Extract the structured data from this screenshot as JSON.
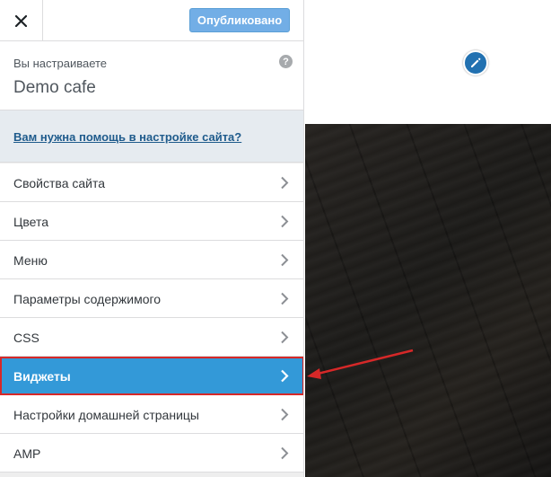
{
  "header": {
    "publish_label": "Опубликовано"
  },
  "info": {
    "label": "Вы настраиваете",
    "site_name": "Demo cafe"
  },
  "help": {
    "link_text": "Вам нужна помощь в настройке сайта?"
  },
  "menu": {
    "items": [
      {
        "label": "Свойства сайта"
      },
      {
        "label": "Цвета"
      },
      {
        "label": "Меню"
      },
      {
        "label": "Параметры содержимого"
      },
      {
        "label": "CSS"
      },
      {
        "label": "Виджеты",
        "active": true
      },
      {
        "label": "Настройки домашней страницы"
      },
      {
        "label": "AMP"
      }
    ]
  },
  "icons": {
    "close": "close-icon",
    "help": "help-icon",
    "chevron": "chevron-right-icon",
    "edit": "pencil-icon"
  },
  "colors": {
    "accent": "#3399d8",
    "highlight_border": "#d62828",
    "publish_button": "#72aee6"
  }
}
